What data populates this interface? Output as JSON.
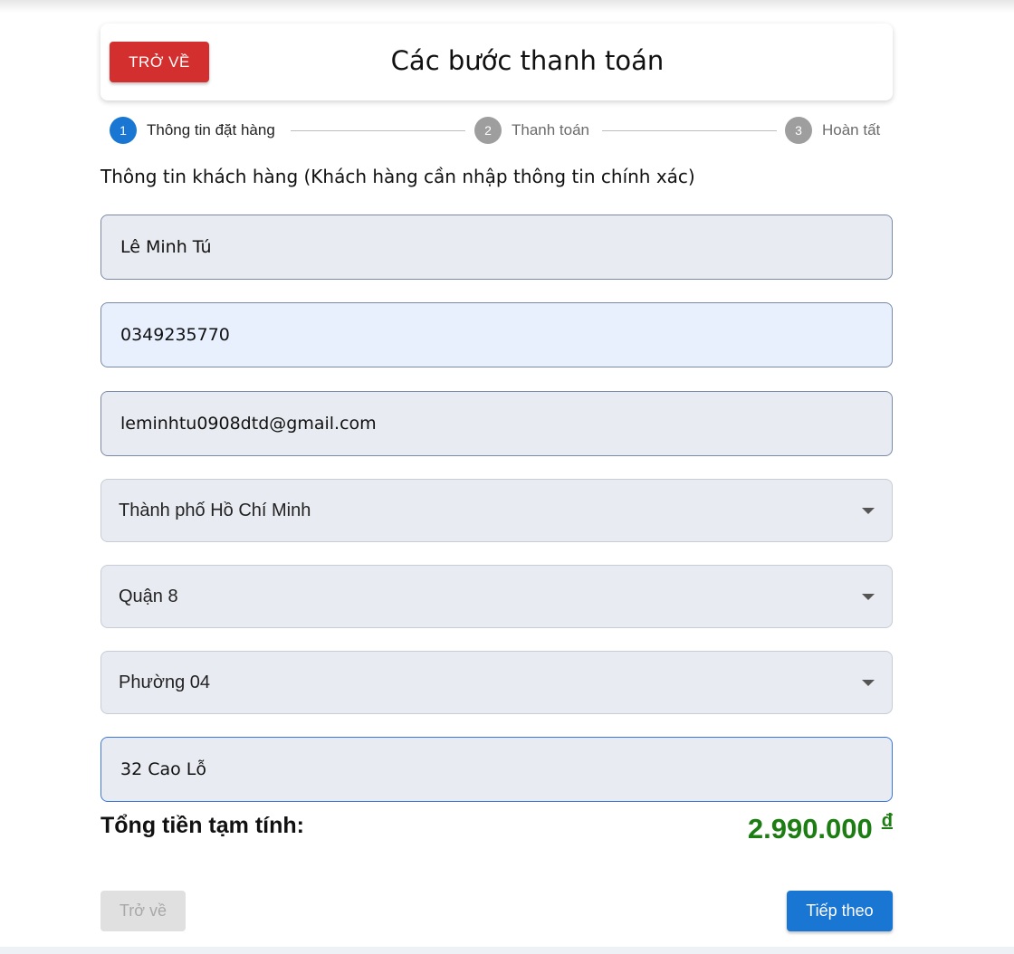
{
  "header": {
    "back_label": "TRỞ VỀ",
    "title": "Các bước thanh toán"
  },
  "stepper": {
    "steps": [
      {
        "number": "1",
        "label": "Thông tin đặt hàng",
        "state": "active"
      },
      {
        "number": "2",
        "label": "Thanh toán",
        "state": "inactive"
      },
      {
        "number": "3",
        "label": "Hoàn tất",
        "state": "inactive"
      }
    ]
  },
  "form": {
    "heading": "Thông tin khách hàng (Khách hàng cần nhập thông tin chính xác)",
    "name": "Lê Minh Tú",
    "phone": "0349235770",
    "email": "leminhtu0908dtd@gmail.com",
    "city": "Thành phố Hồ Chí Minh",
    "district": "Quận 8",
    "ward": "Phường 04",
    "address": "32 Cao Lỗ"
  },
  "total": {
    "label": "Tổng tiền tạm tính:",
    "amount": "2.990.000",
    "currency": "đ"
  },
  "actions": {
    "back_label": "Trở về",
    "next_label": "Tiếp theo"
  },
  "colors": {
    "back_button": "#d32f2f",
    "primary": "#1976d2",
    "total_amount": "#1b7d12"
  }
}
